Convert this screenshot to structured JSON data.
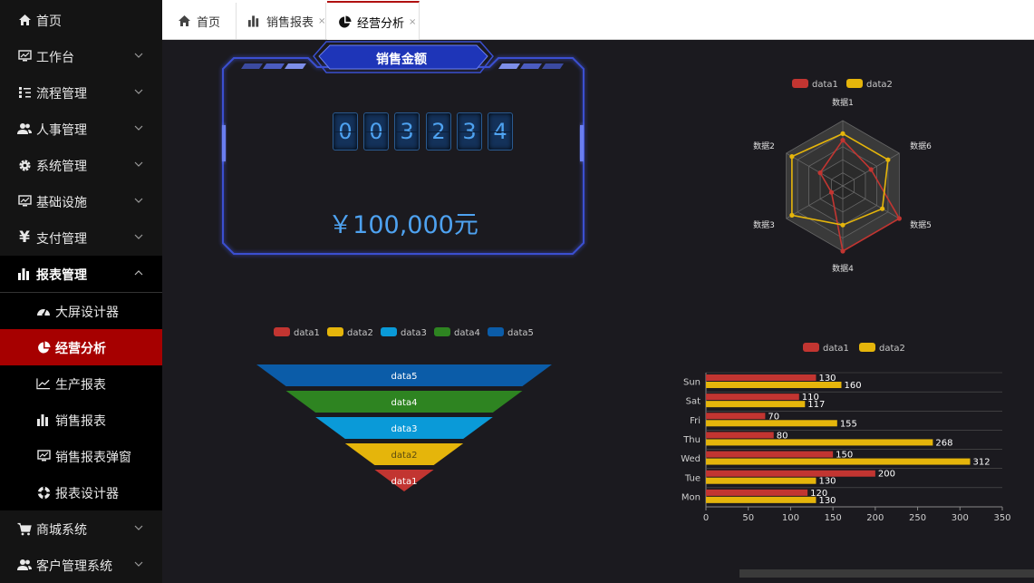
{
  "sidebar": {
    "items": [
      {
        "label": "首页",
        "icon": "home-icon"
      },
      {
        "label": "工作台",
        "icon": "monitor-icon"
      },
      {
        "label": "流程管理",
        "icon": "flow-icon"
      },
      {
        "label": "人事管理",
        "icon": "users-icon"
      },
      {
        "label": "系统管理",
        "icon": "gear-icon"
      },
      {
        "label": "基础设施",
        "icon": "monitor-icon"
      },
      {
        "label": "支付管理",
        "icon": "yen-icon"
      },
      {
        "label": "报表管理",
        "icon": "bar-chart-icon"
      },
      {
        "label": "商城系统",
        "icon": "cart-icon"
      },
      {
        "label": "客户管理系统",
        "icon": "users-icon"
      }
    ],
    "subitems": [
      {
        "label": "大屏设计器",
        "icon": "dashboard-icon"
      },
      {
        "label": "经营分析",
        "icon": "pie-chart-icon"
      },
      {
        "label": "生产报表",
        "icon": "line-chart-icon"
      },
      {
        "label": "销售报表",
        "icon": "bar-chart-icon"
      },
      {
        "label": "销售报表弹窗",
        "icon": "monitor-icon"
      },
      {
        "label": "报表设计器",
        "icon": "lifebuoy-icon"
      }
    ]
  },
  "tabs": [
    {
      "label": "首页",
      "icon": "home-icon"
    },
    {
      "label": "销售报表",
      "icon": "bar-chart-icon",
      "close": "×"
    },
    {
      "label": "经营分析",
      "icon": "pie-chart-icon",
      "close": "×"
    }
  ],
  "counter": {
    "title": "销售金额",
    "digits": [
      "0",
      "0",
      "3",
      "2",
      "3",
      "4"
    ],
    "amount": "￥100,000元"
  },
  "colors": {
    "data1": "#c23531",
    "data2": "#e5b50b",
    "data3": "#0a9ad8",
    "data4": "#2e8421",
    "data5": "#0b5ca8",
    "active_menu": "#a60000"
  },
  "chart_data": [
    {
      "type": "radar",
      "legend": [
        "data1",
        "data2"
      ],
      "indicators": [
        "数据1",
        "数据6",
        "数据5",
        "数据4",
        "数据3",
        "数据2"
      ],
      "series": [
        {
          "name": "data1",
          "values": [
            0.7,
            0.5,
            1.0,
            1.0,
            0.2,
            0.4
          ]
        },
        {
          "name": "data2",
          "values": [
            0.8,
            0.8,
            0.7,
            0.6,
            0.9,
            0.9
          ]
        }
      ]
    },
    {
      "type": "funnel",
      "legend": [
        "data1",
        "data2",
        "data3",
        "data4",
        "data5"
      ],
      "layers": [
        "data5",
        "data4",
        "data3",
        "data2",
        "data1"
      ],
      "values": [
        100,
        80,
        60,
        40,
        20
      ]
    },
    {
      "type": "bar",
      "orientation": "horizontal",
      "legend": [
        "data1",
        "data2"
      ],
      "categories": [
        "Mon",
        "Tue",
        "Wed",
        "Thu",
        "Fri",
        "Sat",
        "Sun"
      ],
      "series": [
        {
          "name": "data1",
          "values": [
            120,
            200,
            150,
            80,
            70,
            110,
            130
          ]
        },
        {
          "name": "data2",
          "values": [
            130,
            130,
            312,
            268,
            155,
            117,
            160
          ]
        }
      ],
      "xlim": [
        0,
        350
      ],
      "xticks": [
        "0",
        "50",
        "100",
        "150",
        "200",
        "250",
        "300",
        "350"
      ]
    }
  ]
}
